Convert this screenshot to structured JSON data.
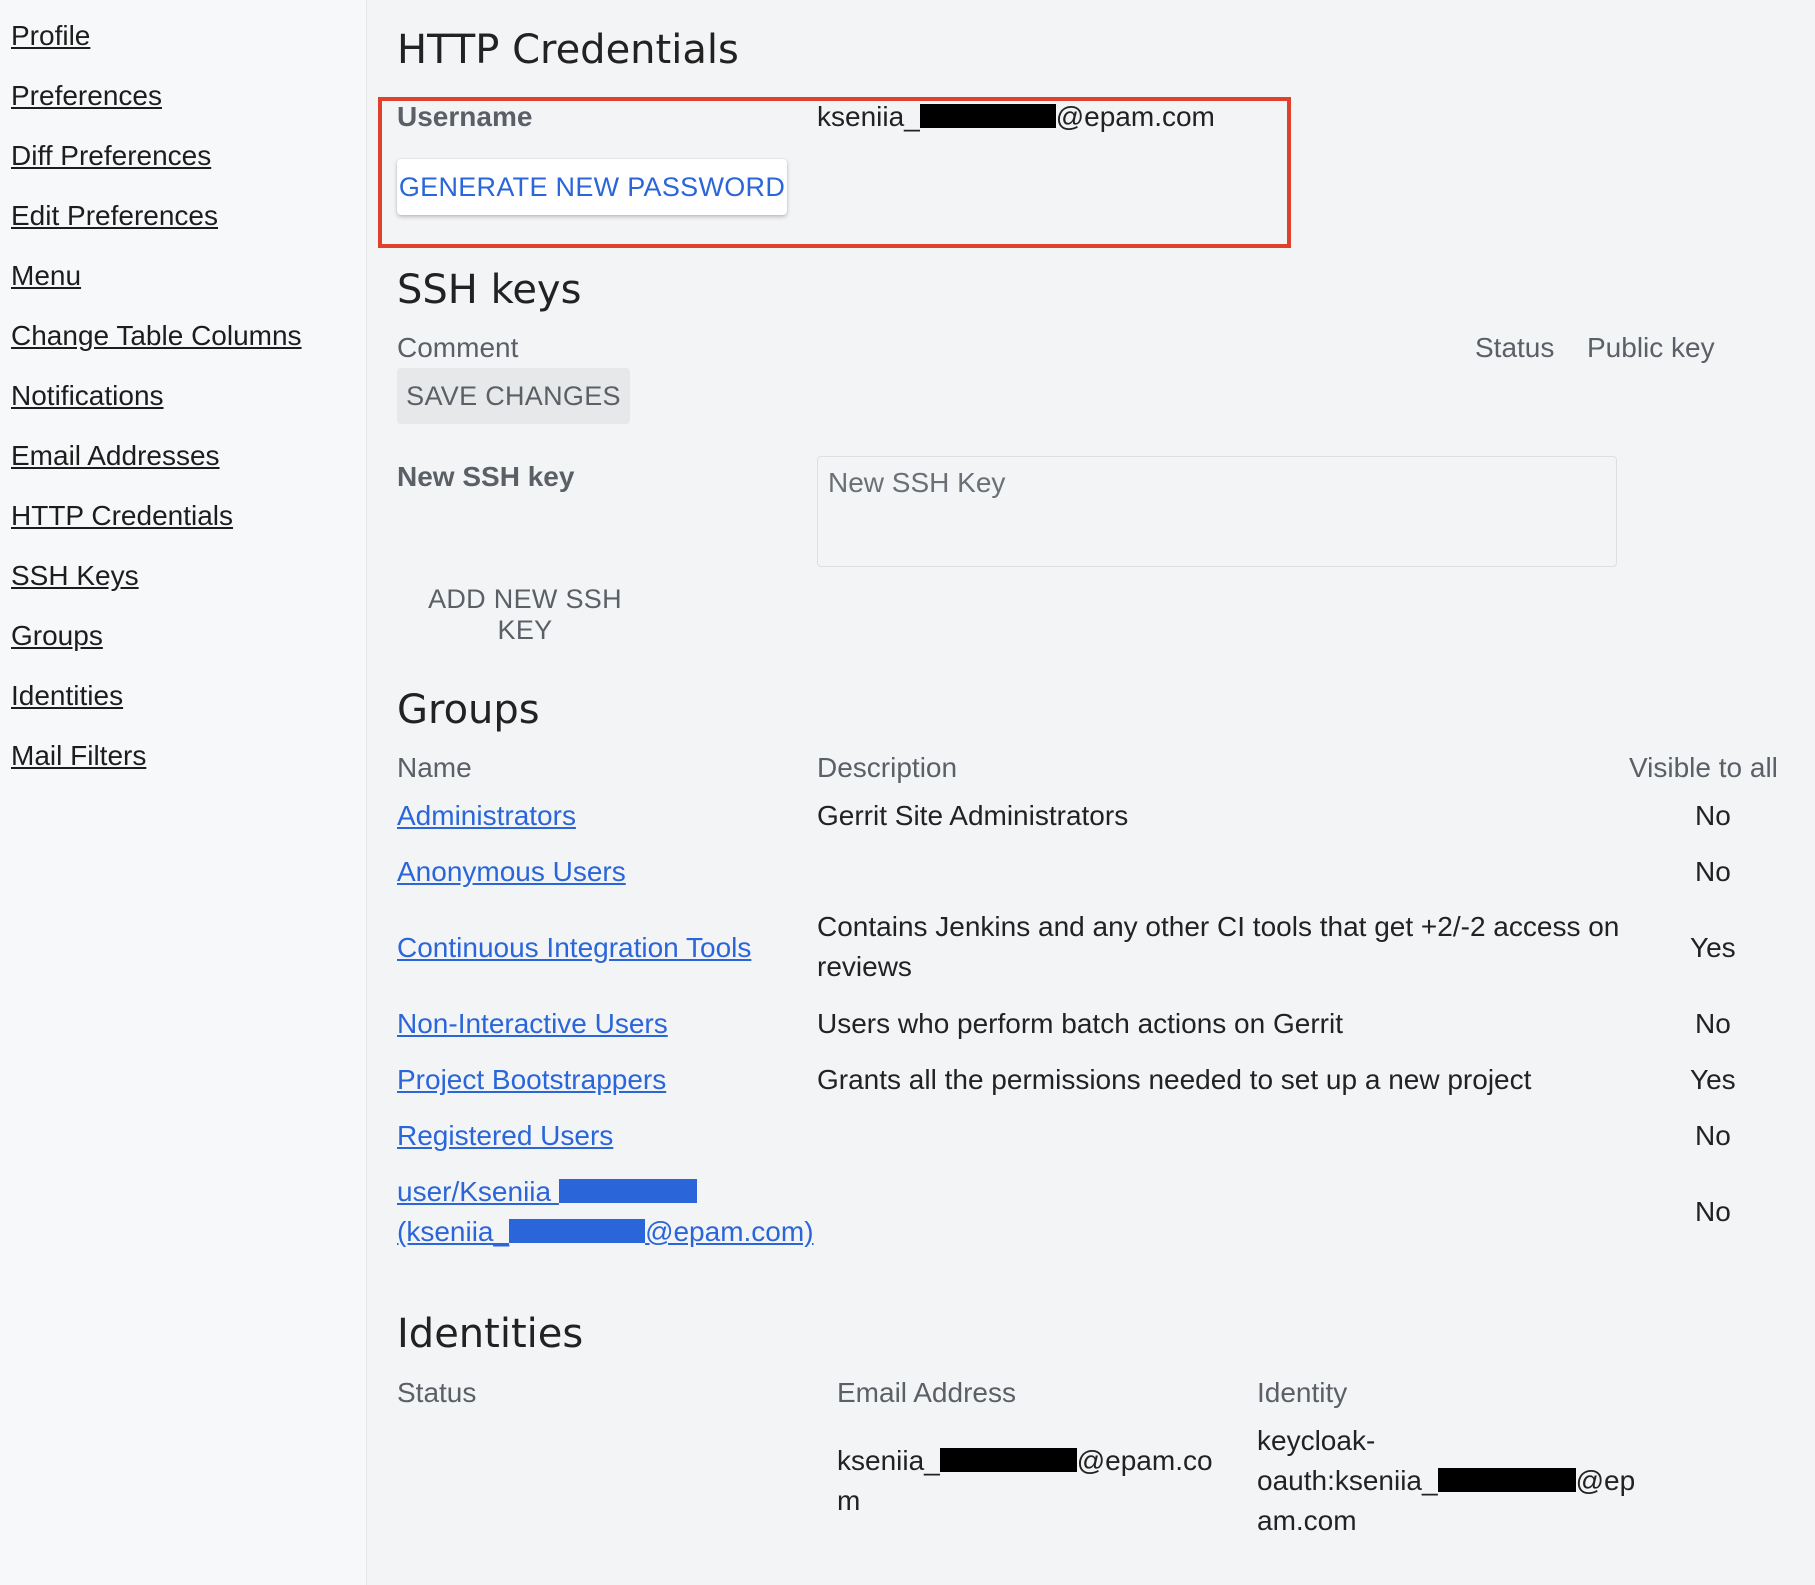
{
  "sidebar": {
    "items": [
      {
        "label": "Profile"
      },
      {
        "label": "Preferences"
      },
      {
        "label": "Diff Preferences"
      },
      {
        "label": "Edit Preferences"
      },
      {
        "label": "Menu"
      },
      {
        "label": "Change Table Columns"
      },
      {
        "label": "Notifications"
      },
      {
        "label": "Email Addresses"
      },
      {
        "label": "HTTP Credentials"
      },
      {
        "label": "SSH Keys"
      },
      {
        "label": "Groups"
      },
      {
        "label": "Identities"
      },
      {
        "label": "Mail Filters"
      }
    ]
  },
  "http_credentials": {
    "title": "HTTP Credentials",
    "username_label": "Username",
    "username_prefix": "kseniia_",
    "username_suffix": "@epam.com",
    "generate_button": "GENERATE NEW PASSWORD"
  },
  "ssh_keys": {
    "title": "SSH keys",
    "col_comment": "Comment",
    "col_status": "Status",
    "col_public_key": "Public key",
    "save_button": "SAVE CHANGES",
    "new_key_label": "New SSH key",
    "new_key_placeholder": "New SSH Key",
    "add_button": "ADD NEW SSH KEY"
  },
  "groups": {
    "title": "Groups",
    "col_name": "Name",
    "col_description": "Description",
    "col_visible": "Visible to all",
    "rows": [
      {
        "name": "Administrators",
        "description": "Gerrit Site Administrators",
        "visible": "No"
      },
      {
        "name": "Anonymous Users",
        "description": "",
        "visible": "No"
      },
      {
        "name": "Continuous Integration Tools",
        "description": "Contains Jenkins and any other CI tools that get +2/-2 access on reviews",
        "visible": "Yes"
      },
      {
        "name": "Non-Interactive Users",
        "description": "Users who perform batch actions on Gerrit",
        "visible": "No"
      },
      {
        "name": "Project Bootstrappers",
        "description": "Grants all the permissions needed to set up a new project",
        "visible": "Yes"
      },
      {
        "name": "Registered Users",
        "description": "",
        "visible": "No"
      },
      {
        "name_line1": "user/Kseniia ",
        "name_line2_prefix": "(kseniia_",
        "name_line2_suffix": "@epam.com)",
        "description": "",
        "visible": "No"
      }
    ]
  },
  "identities": {
    "title": "Identities",
    "col_status": "Status",
    "col_email": "Email Address",
    "col_identity": "Identity",
    "email_prefix": "kseniia_",
    "email_suffix_1": "@epam.co",
    "email_suffix_2": "m",
    "identity_line1": "keycloak-",
    "identity_line2_prefix": "oauth:kseniia_",
    "identity_line2_suffix": "@ep",
    "identity_line3": "am.com"
  },
  "colors": {
    "accent": "#2a66d9",
    "highlight": "#e0412c",
    "background": "#f3f4f6"
  }
}
